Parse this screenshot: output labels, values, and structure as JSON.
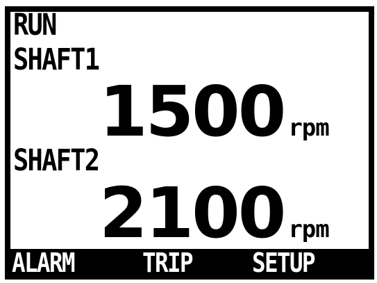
{
  "display": {
    "mode": "RUN",
    "shafts": [
      {
        "label": "SHAFT1",
        "value": "1500",
        "unit": "rpm"
      },
      {
        "label": "SHAFT2",
        "value": "2100",
        "unit": "rpm"
      }
    ],
    "softkeys": [
      {
        "label": "ALARM"
      },
      {
        "label": "TRIP"
      },
      {
        "label": "SETUP"
      }
    ]
  },
  "colors": {
    "foreground": "#000000",
    "background": "#ffffff",
    "softkey_text": "#ffffff"
  }
}
